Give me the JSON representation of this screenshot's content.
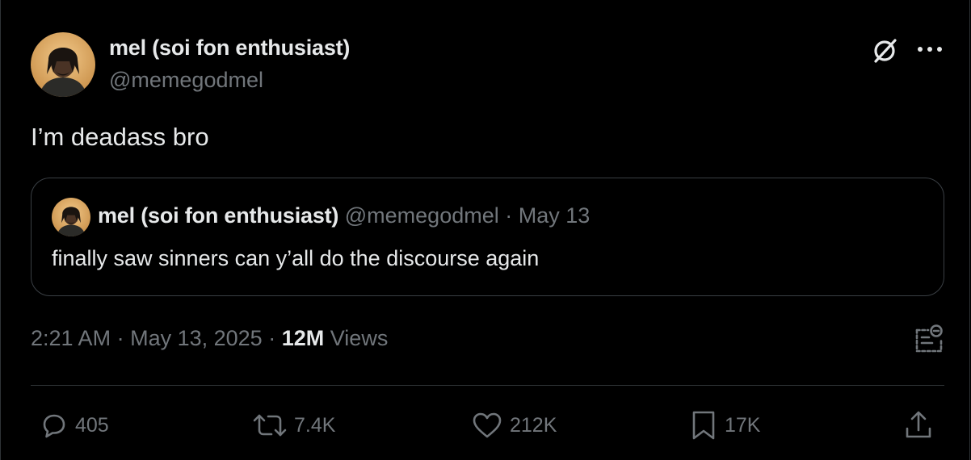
{
  "author": {
    "display_name": "mel (soi fon enthusiast)",
    "handle": "@memegodmel"
  },
  "tweet": {
    "text": "I’m deadass bro"
  },
  "quoted_tweet": {
    "display_name": "mel (soi fon enthusiast)",
    "handle": "@memegodmel",
    "separator": "·",
    "date": "May 13",
    "text": "finally saw sinners can y’all do the discourse again"
  },
  "meta": {
    "time": "2:21 AM",
    "separator": "·",
    "date": "May 13, 2025",
    "views_count": "12M",
    "views_label": "Views"
  },
  "actions": {
    "replies": "405",
    "reposts": "7.4K",
    "likes": "212K",
    "bookmarks": "17K"
  },
  "icons": {
    "top_right": [
      "grok-icon",
      "more-icon"
    ],
    "footer": [
      "analytics-icon"
    ],
    "actions": [
      "reply-icon",
      "repost-icon",
      "like-icon",
      "bookmark-icon",
      "share-icon"
    ]
  },
  "colors": {
    "background": "#000000",
    "text_primary": "#e7e9ea",
    "text_secondary": "#71767b",
    "border": "#2f3336"
  }
}
